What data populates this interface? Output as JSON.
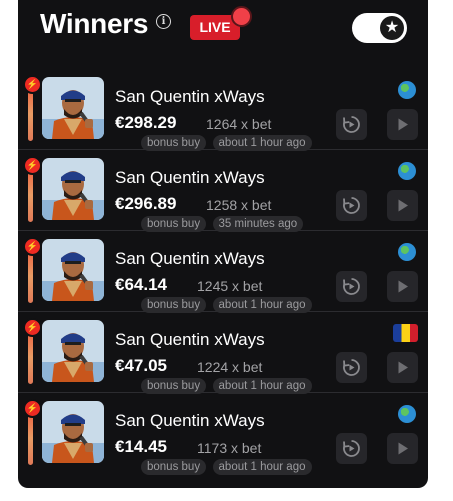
{
  "header": {
    "title": "Winners",
    "info_icon": "info-icon",
    "live_label": "LIVE",
    "toggle_icon": "star-icon",
    "toggle_on": true
  },
  "colors": {
    "background": "#111113",
    "live_badge": "#d81e2a",
    "row_button": "#26262a",
    "tag_bg": "#2a2a2d"
  },
  "winners": [
    {
      "game": "San Quentin xWays",
      "amount": "€298.29",
      "multiplier": "1264 x bet",
      "tags": [
        "bonus buy",
        "about 1 hour ago"
      ],
      "flag": "globe-icon"
    },
    {
      "game": "San Quentin xWays",
      "amount": "€296.89",
      "multiplier": "1258 x bet",
      "tags": [
        "bonus buy",
        "35 minutes ago"
      ],
      "flag": "globe-icon"
    },
    {
      "game": "San Quentin xWays",
      "amount": "€64.14",
      "multiplier": "1245 x bet",
      "tags": [
        "bonus buy",
        "about 1 hour ago"
      ],
      "flag": "globe-icon"
    },
    {
      "game": "San Quentin xWays",
      "amount": "€47.05",
      "multiplier": "1224 x bet",
      "tags": [
        "bonus buy",
        "about 1 hour ago"
      ],
      "flag": "romania-flag-icon"
    },
    {
      "game": "San Quentin xWays",
      "amount": "€14.45",
      "multiplier": "1173 x bet",
      "tags": [
        "bonus buy",
        "about 1 hour ago"
      ],
      "flag": "globe-icon"
    }
  ]
}
